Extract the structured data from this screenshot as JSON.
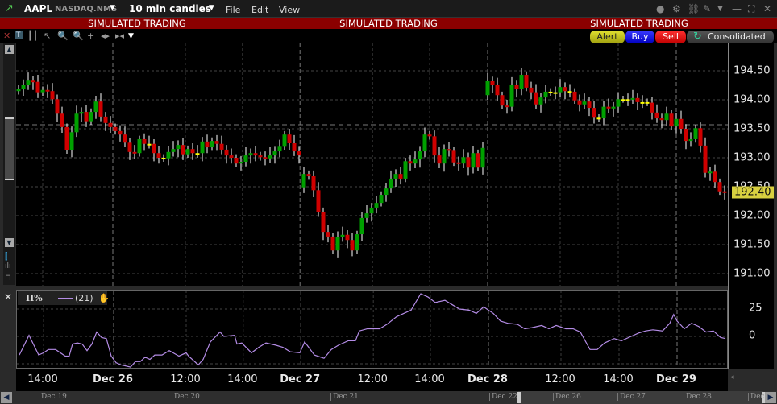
{
  "window": {
    "symbol": "AAPL",
    "exchange": "NASDAQ.NMS",
    "interval": "10 min candles",
    "menus": [
      "File",
      "Edit",
      "View"
    ]
  },
  "banner": {
    "text": "SIMULATED TRADING"
  },
  "order_buttons": {
    "alert": "Alert",
    "buy": "Buy",
    "sell": "Sell",
    "consolidated": "Consolidated"
  },
  "colors": {
    "up": "#00a000",
    "down": "#d00000",
    "doji": "#ffff00",
    "indicator": "#b48ce6",
    "banner": "#8b0000",
    "last_price_badge": "#d8d040"
  },
  "chart_data": [
    {
      "type": "candlestick",
      "title": "AAPL 10 min candles",
      "ylim": [
        190.9,
        194.75
      ],
      "y_ticks": [
        "194.50",
        "194.00",
        "193.50",
        "193.00",
        "192.50",
        "192.00",
        "191.50",
        "191.00"
      ],
      "y_tick_values": [
        194.5,
        194.0,
        193.5,
        193.0,
        192.5,
        192.0,
        191.5,
        191.0
      ],
      "last_price": "192.40",
      "reference_line": 193.57,
      "x_tick_labels": [
        {
          "label": "14:00",
          "index": 5,
          "bold": false
        },
        {
          "label": "Dec 26",
          "index": 19.5,
          "bold": true
        },
        {
          "label": "12:00",
          "index": 34.5,
          "bold": false
        },
        {
          "label": "14:00",
          "index": 46.3,
          "bold": false
        },
        {
          "label": "Dec 27",
          "index": 58.2,
          "bold": true
        },
        {
          "label": "12:00",
          "index": 73.2,
          "bold": false
        },
        {
          "label": "14:00",
          "index": 85,
          "bold": false
        },
        {
          "label": "Dec 28",
          "index": 97,
          "bold": true
        },
        {
          "label": "12:00",
          "index": 112,
          "bold": false
        },
        {
          "label": "14:00",
          "index": 124,
          "bold": false
        },
        {
          "label": "Dec 29",
          "index": 136,
          "bold": true
        }
      ],
      "day_breaks": [
        19.5,
        58.2,
        97,
        136
      ],
      "gap_opens": {
        "59": 192.49,
        "97": 194.08
      },
      "first_open": 194.15,
      "close": [
        194.19,
        194.25,
        194.33,
        194.31,
        194.13,
        194.17,
        194.15,
        194.01,
        193.76,
        193.53,
        193.13,
        193.44,
        193.76,
        193.79,
        193.63,
        193.79,
        193.97,
        193.71,
        193.6,
        193.53,
        193.46,
        193.4,
        193.26,
        193.1,
        193.08,
        193.32,
        193.24,
        193.24,
        193.08,
        193.0,
        192.99,
        193.1,
        193.15,
        193.22,
        193.06,
        193.15,
        193.08,
        193.08,
        193.28,
        193.18,
        193.29,
        193.24,
        193.14,
        193.04,
        193.0,
        192.9,
        192.93,
        193.04,
        193.08,
        193.04,
        193.01,
        192.99,
        193.04,
        193.11,
        193.19,
        193.4,
        193.25,
        193.11,
        193.04,
        192.72,
        192.68,
        192.44,
        192.06,
        191.72,
        191.64,
        191.4,
        191.63,
        191.67,
        191.58,
        191.4,
        191.68,
        191.96,
        192.04,
        192.14,
        192.22,
        192.36,
        192.47,
        192.64,
        192.72,
        192.64,
        192.94,
        192.9,
        192.97,
        193.11,
        193.4,
        193.37,
        193.04,
        192.9,
        193.15,
        193.12,
        192.92,
        192.9,
        193.01,
        192.83,
        193.08,
        192.83,
        193.17,
        194.32,
        194.26,
        194.08,
        193.9,
        193.88,
        194.25,
        194.18,
        194.43,
        194.21,
        194.13,
        193.92,
        194.04,
        194.14,
        194.13,
        194.13,
        194.22,
        194.15,
        194.14,
        193.99,
        193.92,
        193.97,
        193.86,
        193.69,
        193.68,
        193.88,
        193.85,
        193.88,
        194.01,
        194.01,
        194.01,
        194.03,
        193.96,
        193.96,
        193.95,
        193.78,
        193.68,
        193.65,
        193.76,
        193.54,
        193.67,
        193.5,
        193.29,
        193.32,
        193.51,
        193.21,
        192.74,
        192.76,
        192.58,
        192.42,
        192.4
      ]
    },
    {
      "type": "line",
      "title": "II%",
      "legend": "(21)",
      "y_ticks": [
        "25",
        "0"
      ],
      "y_tick_values": [
        25,
        0
      ],
      "ylim": [
        -33,
        39
      ],
      "points": [
        [
          0,
          -17
        ],
        [
          2,
          1
        ],
        [
          4,
          -17
        ],
        [
          5,
          -15
        ],
        [
          6,
          -12
        ],
        [
          7.5,
          -12
        ],
        [
          9.5,
          -18
        ],
        [
          10.3,
          -18
        ],
        [
          11,
          -7
        ],
        [
          12,
          -6
        ],
        [
          13,
          -7
        ],
        [
          14,
          -13
        ],
        [
          15,
          -7
        ],
        [
          16,
          4
        ],
        [
          17,
          -1
        ],
        [
          18,
          -2
        ],
        [
          19,
          -18
        ],
        [
          20,
          -24
        ],
        [
          21,
          -26
        ],
        [
          23,
          -28
        ],
        [
          24,
          -23
        ],
        [
          25,
          -23
        ],
        [
          26,
          -19
        ],
        [
          27,
          -21
        ],
        [
          28,
          -17
        ],
        [
          29.5,
          -17
        ],
        [
          31,
          -13
        ],
        [
          33,
          -18
        ],
        [
          34.5,
          -15
        ],
        [
          35,
          -18
        ],
        [
          37,
          -26
        ],
        [
          38,
          -21
        ],
        [
          39.5,
          -5
        ],
        [
          41.5,
          4
        ],
        [
          42.3,
          0
        ],
        [
          44.5,
          1
        ],
        [
          45,
          -7
        ],
        [
          46,
          -6
        ],
        [
          48,
          -15
        ],
        [
          49.5,
          -10
        ],
        [
          51,
          -6
        ],
        [
          53,
          -8
        ],
        [
          54.5,
          -10
        ],
        [
          56,
          -14
        ],
        [
          58,
          -15
        ],
        [
          59,
          -5
        ],
        [
          61,
          -17
        ],
        [
          63,
          -20
        ],
        [
          64.5,
          -12
        ],
        [
          66,
          -8
        ],
        [
          68,
          -4
        ],
        [
          69.5,
          -4
        ],
        [
          70.3,
          5
        ],
        [
          72,
          7
        ],
        [
          74.5,
          7
        ],
        [
          76,
          11
        ],
        [
          78,
          18
        ],
        [
          79.5,
          21
        ],
        [
          81,
          24
        ],
        [
          83,
          39
        ],
        [
          84.5,
          36
        ],
        [
          86,
          31
        ],
        [
          88,
          33
        ],
        [
          89.5,
          29
        ],
        [
          91,
          25
        ],
        [
          93,
          24
        ],
        [
          94.5,
          21
        ],
        [
          96,
          27
        ],
        [
          98,
          21
        ],
        [
          99.5,
          14
        ],
        [
          101,
          12
        ],
        [
          103,
          11
        ],
        [
          104.5,
          7
        ],
        [
          106,
          8
        ],
        [
          108,
          10
        ],
        [
          109.5,
          7
        ],
        [
          111,
          10
        ],
        [
          113,
          7
        ],
        [
          114.5,
          7
        ],
        [
          116,
          4
        ],
        [
          118,
          -12
        ],
        [
          119.5,
          -12
        ],
        [
          121,
          -6
        ],
        [
          123,
          -2
        ],
        [
          124.5,
          -4
        ],
        [
          126,
          -1
        ],
        [
          128,
          3
        ],
        [
          129.5,
          5
        ],
        [
          131,
          6
        ],
        [
          133,
          5
        ],
        [
          134.5,
          12
        ],
        [
          135.3,
          20
        ],
        [
          136,
          14
        ],
        [
          137.5,
          7
        ],
        [
          139,
          12
        ],
        [
          140.5,
          9
        ],
        [
          142,
          4
        ],
        [
          143.5,
          5
        ],
        [
          145,
          -1
        ],
        [
          146,
          -2
        ]
      ]
    }
  ],
  "navigator": {
    "labels": [
      "Dec 19",
      "Dec 20",
      "Dec 21",
      "Dec 22",
      "Dec 26",
      "Dec 27",
      "Dec 28",
      "Dec"
    ]
  }
}
